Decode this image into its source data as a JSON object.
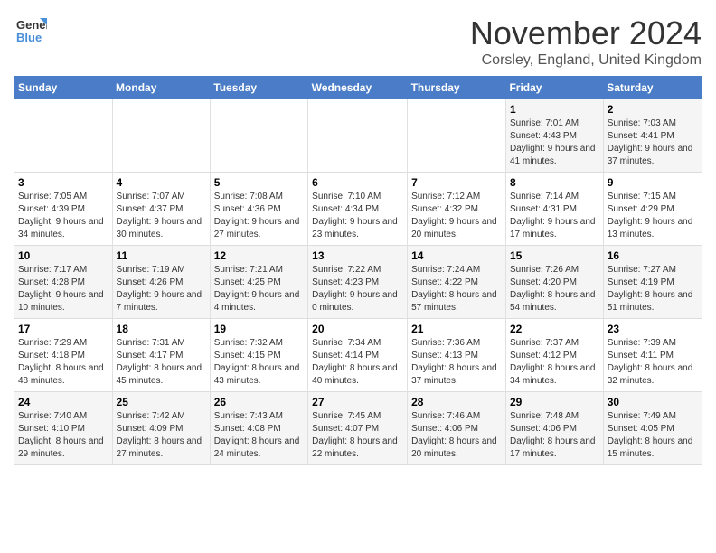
{
  "header": {
    "logo_general": "General",
    "logo_blue": "Blue",
    "month_title": "November 2024",
    "location": "Corsley, England, United Kingdom"
  },
  "weekdays": [
    "Sunday",
    "Monday",
    "Tuesday",
    "Wednesday",
    "Thursday",
    "Friday",
    "Saturday"
  ],
  "weeks": [
    [
      {
        "day": "",
        "info": ""
      },
      {
        "day": "",
        "info": ""
      },
      {
        "day": "",
        "info": ""
      },
      {
        "day": "",
        "info": ""
      },
      {
        "day": "",
        "info": ""
      },
      {
        "day": "1",
        "info": "Sunrise: 7:01 AM\nSunset: 4:43 PM\nDaylight: 9 hours and 41 minutes."
      },
      {
        "day": "2",
        "info": "Sunrise: 7:03 AM\nSunset: 4:41 PM\nDaylight: 9 hours and 37 minutes."
      }
    ],
    [
      {
        "day": "3",
        "info": "Sunrise: 7:05 AM\nSunset: 4:39 PM\nDaylight: 9 hours and 34 minutes."
      },
      {
        "day": "4",
        "info": "Sunrise: 7:07 AM\nSunset: 4:37 PM\nDaylight: 9 hours and 30 minutes."
      },
      {
        "day": "5",
        "info": "Sunrise: 7:08 AM\nSunset: 4:36 PM\nDaylight: 9 hours and 27 minutes."
      },
      {
        "day": "6",
        "info": "Sunrise: 7:10 AM\nSunset: 4:34 PM\nDaylight: 9 hours and 23 minutes."
      },
      {
        "day": "7",
        "info": "Sunrise: 7:12 AM\nSunset: 4:32 PM\nDaylight: 9 hours and 20 minutes."
      },
      {
        "day": "8",
        "info": "Sunrise: 7:14 AM\nSunset: 4:31 PM\nDaylight: 9 hours and 17 minutes."
      },
      {
        "day": "9",
        "info": "Sunrise: 7:15 AM\nSunset: 4:29 PM\nDaylight: 9 hours and 13 minutes."
      }
    ],
    [
      {
        "day": "10",
        "info": "Sunrise: 7:17 AM\nSunset: 4:28 PM\nDaylight: 9 hours and 10 minutes."
      },
      {
        "day": "11",
        "info": "Sunrise: 7:19 AM\nSunset: 4:26 PM\nDaylight: 9 hours and 7 minutes."
      },
      {
        "day": "12",
        "info": "Sunrise: 7:21 AM\nSunset: 4:25 PM\nDaylight: 9 hours and 4 minutes."
      },
      {
        "day": "13",
        "info": "Sunrise: 7:22 AM\nSunset: 4:23 PM\nDaylight: 9 hours and 0 minutes."
      },
      {
        "day": "14",
        "info": "Sunrise: 7:24 AM\nSunset: 4:22 PM\nDaylight: 8 hours and 57 minutes."
      },
      {
        "day": "15",
        "info": "Sunrise: 7:26 AM\nSunset: 4:20 PM\nDaylight: 8 hours and 54 minutes."
      },
      {
        "day": "16",
        "info": "Sunrise: 7:27 AM\nSunset: 4:19 PM\nDaylight: 8 hours and 51 minutes."
      }
    ],
    [
      {
        "day": "17",
        "info": "Sunrise: 7:29 AM\nSunset: 4:18 PM\nDaylight: 8 hours and 48 minutes."
      },
      {
        "day": "18",
        "info": "Sunrise: 7:31 AM\nSunset: 4:17 PM\nDaylight: 8 hours and 45 minutes."
      },
      {
        "day": "19",
        "info": "Sunrise: 7:32 AM\nSunset: 4:15 PM\nDaylight: 8 hours and 43 minutes."
      },
      {
        "day": "20",
        "info": "Sunrise: 7:34 AM\nSunset: 4:14 PM\nDaylight: 8 hours and 40 minutes."
      },
      {
        "day": "21",
        "info": "Sunrise: 7:36 AM\nSunset: 4:13 PM\nDaylight: 8 hours and 37 minutes."
      },
      {
        "day": "22",
        "info": "Sunrise: 7:37 AM\nSunset: 4:12 PM\nDaylight: 8 hours and 34 minutes."
      },
      {
        "day": "23",
        "info": "Sunrise: 7:39 AM\nSunset: 4:11 PM\nDaylight: 8 hours and 32 minutes."
      }
    ],
    [
      {
        "day": "24",
        "info": "Sunrise: 7:40 AM\nSunset: 4:10 PM\nDaylight: 8 hours and 29 minutes."
      },
      {
        "day": "25",
        "info": "Sunrise: 7:42 AM\nSunset: 4:09 PM\nDaylight: 8 hours and 27 minutes."
      },
      {
        "day": "26",
        "info": "Sunrise: 7:43 AM\nSunset: 4:08 PM\nDaylight: 8 hours and 24 minutes."
      },
      {
        "day": "27",
        "info": "Sunrise: 7:45 AM\nSunset: 4:07 PM\nDaylight: 8 hours and 22 minutes."
      },
      {
        "day": "28",
        "info": "Sunrise: 7:46 AM\nSunset: 4:06 PM\nDaylight: 8 hours and 20 minutes."
      },
      {
        "day": "29",
        "info": "Sunrise: 7:48 AM\nSunset: 4:06 PM\nDaylight: 8 hours and 17 minutes."
      },
      {
        "day": "30",
        "info": "Sunrise: 7:49 AM\nSunset: 4:05 PM\nDaylight: 8 hours and 15 minutes."
      }
    ]
  ]
}
